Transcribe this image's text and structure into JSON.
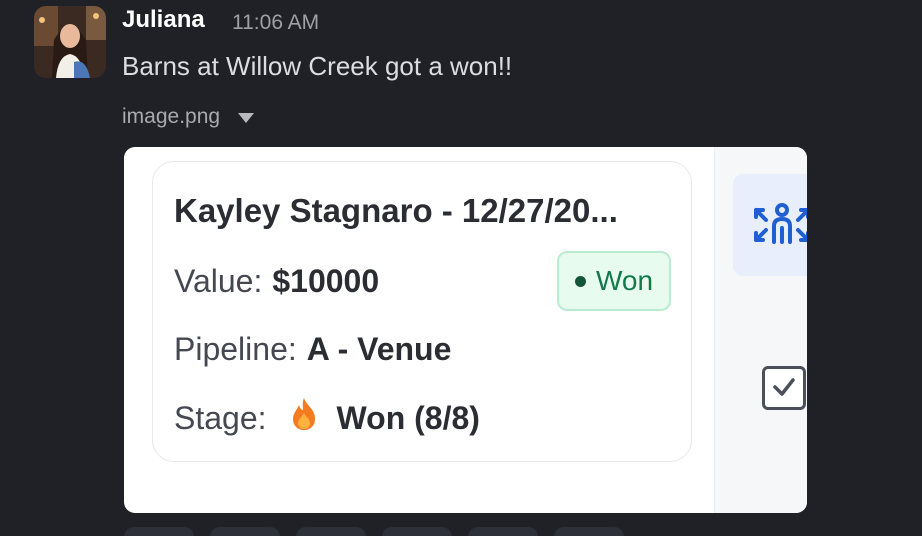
{
  "message": {
    "sender": "Juliana",
    "time": "11:06 AM",
    "text": "Barns at Willow Creek got a won!!",
    "avatar_icon": "user-avatar"
  },
  "attachment": {
    "filename": "image.png",
    "toggle_icon": "caret-down-icon"
  },
  "deal_card": {
    "title": "Kayley Stagnaro - 12/27/20...",
    "value_label": "Value:",
    "value": "$10000",
    "status": "Won",
    "pipeline_label": "Pipeline:",
    "pipeline": "A - Venue",
    "stage_label": "Stage:",
    "stage": "Won (8/8)",
    "stage_icon": "flame-icon"
  },
  "side_panel": {
    "team_icon": "team-connect-icon",
    "checkbox_icon": "checkbox-checked-icon"
  },
  "colors": {
    "background": "#1f2127",
    "won_green": "#137a4a",
    "accent_blue": "#1f5fd1"
  }
}
